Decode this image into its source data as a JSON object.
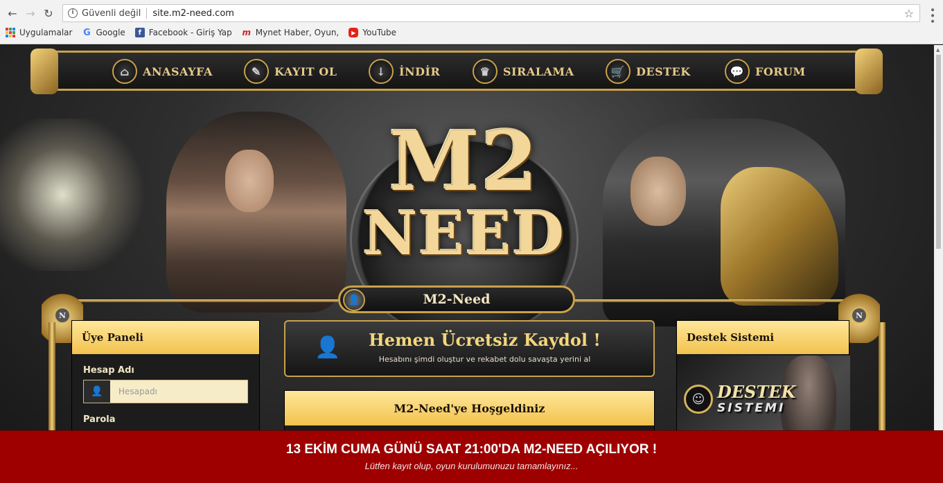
{
  "browser": {
    "security_label": "Güvenli değil",
    "url": "site.m2-need.com",
    "bookmarks": [
      {
        "label": "Uygulamalar",
        "icon": "apps-grid-icon"
      },
      {
        "label": "Google",
        "icon": "google-icon"
      },
      {
        "label": "Facebook - Giriş Yap",
        "icon": "facebook-icon"
      },
      {
        "label": "Mynet  Haber, Oyun,",
        "icon": "mynet-icon"
      },
      {
        "label": "YouTube",
        "icon": "youtube-icon"
      }
    ]
  },
  "nav": {
    "items": [
      {
        "label": "ANASAYFA",
        "icon": "home-icon"
      },
      {
        "label": "KAYIT OL",
        "icon": "register-icon"
      },
      {
        "label": "İNDİR",
        "icon": "download-icon"
      },
      {
        "label": "SIRALAMA",
        "icon": "ranking-icon"
      },
      {
        "label": "DESTEK",
        "icon": "cart-icon"
      },
      {
        "label": "FORUM",
        "icon": "chat-icon"
      }
    ]
  },
  "hero": {
    "logo_line1": "M2",
    "logo_line2": "NEED",
    "banner_title": "M2-Need",
    "corner_letter": "N"
  },
  "member_panel": {
    "title": "Üye Paneli",
    "username_label": "Hesap Adı",
    "username_placeholder": "Hesapadı",
    "password_label": "Parola"
  },
  "signup": {
    "title": "Hemen Ücretsiz Kaydol !",
    "subtitle": "Hesabını şimdi oluştur ve rekabet dolu savaşta yerini al"
  },
  "welcome": {
    "title": "M2-Need'ye Hoşgeldiniz"
  },
  "support": {
    "title": "Destek Sistemi",
    "image_line1": "DESTEK",
    "image_line2": "SISTEMI"
  },
  "announcement": {
    "title": "13 EKİM CUMA GÜNÜ SAAT 21:00'DA M2-NEED AÇILIYOR !",
    "subtitle": "Lütfen kayıt olup, oyun kurulumunuzu tamamlayınız..."
  },
  "colors": {
    "gold": "#c9a24a",
    "panel_head": "#f2c24e",
    "announcement_bg": "#9e0000"
  }
}
